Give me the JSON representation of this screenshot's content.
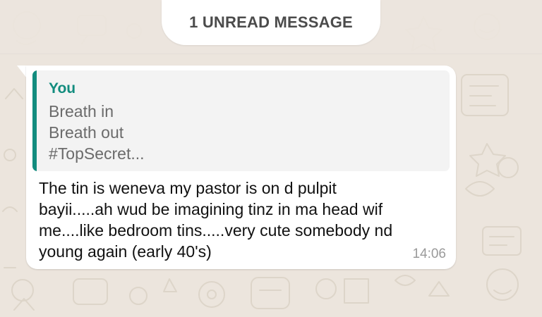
{
  "banner": {
    "unread_label": "1 UNREAD MESSAGE"
  },
  "message": {
    "quote": {
      "sender": "You",
      "lines": [
        "Breath in",
        "Breath out",
        "#TopSecret..."
      ]
    },
    "lines": [
      "The tin is weneva my pastor is on d pulpit",
      "bayii.....ah wud be imagining tinz in ma head wif",
      "me....like bedroom tins.....very cute somebody nd",
      "young again (early 40's)"
    ],
    "time": "14:06"
  },
  "colors": {
    "chat_background": "#ece5dd",
    "bubble": "#ffffff",
    "quote_accent": "#128c7e",
    "quote_background": "#f3f3f3"
  }
}
